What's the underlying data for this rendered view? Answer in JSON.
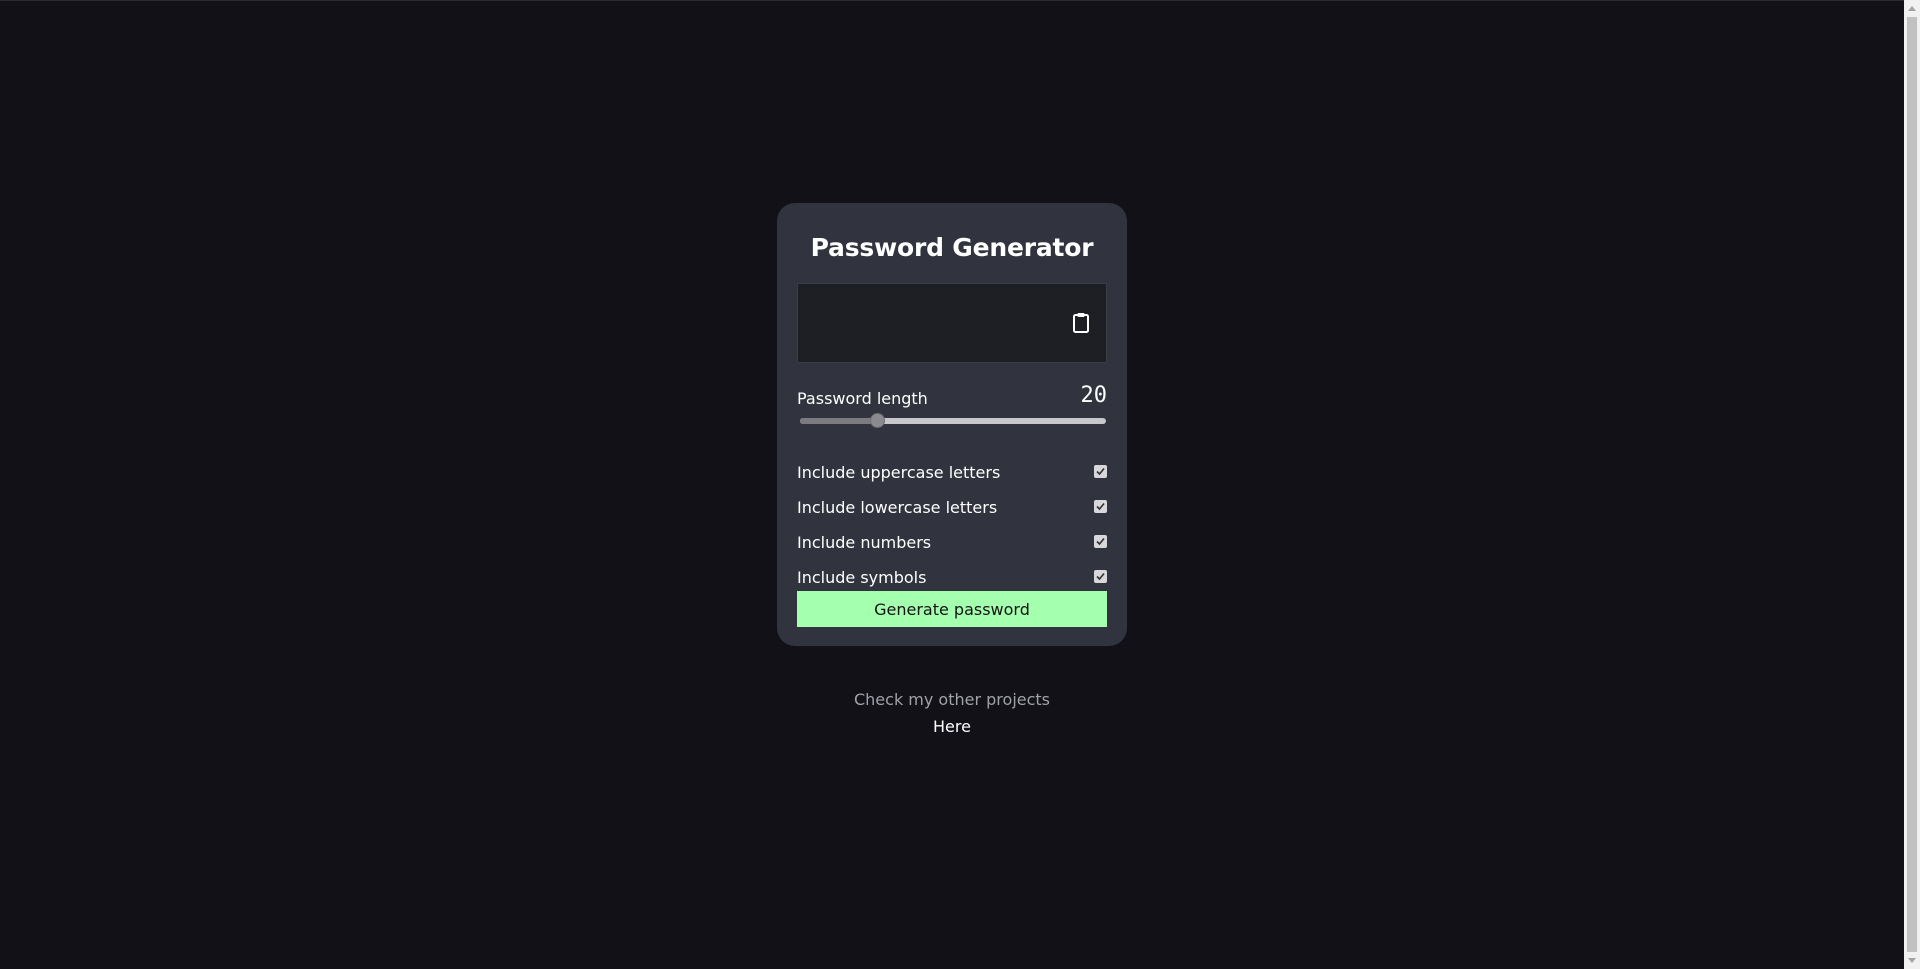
{
  "app": {
    "title": "Password Generator"
  },
  "output": {
    "value": ""
  },
  "length": {
    "label": "Password length",
    "value": "20",
    "min": 0,
    "max": 80,
    "current": 20
  },
  "options": [
    {
      "label": "Include uppercase letters",
      "checked": true
    },
    {
      "label": "Include lowercase letters",
      "checked": true
    },
    {
      "label": "Include numbers",
      "checked": true
    },
    {
      "label": "Include symbols",
      "checked": true
    }
  ],
  "actions": {
    "generate_label": "Generate password"
  },
  "footer": {
    "text": "Check my other projects",
    "link_label": "Here"
  },
  "colors": {
    "background": "#111117",
    "card": "#31343f",
    "output_box": "#1d1f25",
    "accent": "#a4ffaf",
    "muted_text": "#a0a2a8"
  },
  "icons": {
    "copy": "clipboard-icon"
  }
}
